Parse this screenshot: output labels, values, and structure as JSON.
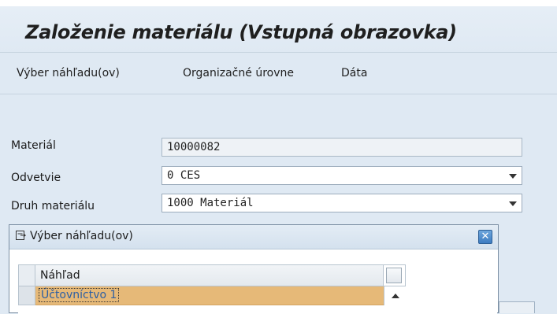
{
  "screen": {
    "title": "Založenie materiálu (Vstupná obrazovka)"
  },
  "toolbar": {
    "items": [
      {
        "label": "Výber náhľadu(ov)"
      },
      {
        "label": "Organizačné úrovne"
      },
      {
        "label": "Dáta"
      }
    ]
  },
  "form": {
    "material": {
      "label": "Materiál",
      "value": "10000082"
    },
    "industry": {
      "label": "Odvetvie",
      "value": "0 CES"
    },
    "material_type": {
      "label": "Druh materiálu",
      "value": "1000 Materiál"
    }
  },
  "popup": {
    "title": "Výber náhľadu(ov)",
    "close_icon": "close-x",
    "table": {
      "column_header": "Náhľad",
      "rows": [
        {
          "label": "Účtovníctvo 1",
          "selected": true
        }
      ]
    }
  },
  "colors": {
    "title_bg": "#e6eef6",
    "body_bg": "#dfe9f3",
    "selected_row": "#e6b978",
    "close_button": "#4f8fd0",
    "row_text": "#2d5fa3"
  }
}
